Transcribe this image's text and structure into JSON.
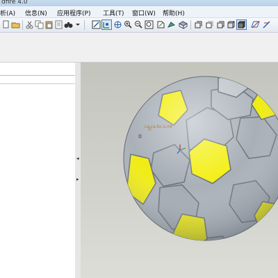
{
  "window": {
    "title": "dfire 4.0"
  },
  "menu": [
    {
      "label": "析(A)"
    },
    {
      "label": "信息(N)"
    },
    {
      "label": "应用程序(P)"
    },
    {
      "label": "工具(T)"
    },
    {
      "label": "窗口(W)"
    },
    {
      "label": "帮助(H)"
    }
  ],
  "toolbar": {
    "icons": [
      "new-icon",
      "open-icon",
      "cut-icon",
      "copy-icon",
      "paste-icon",
      "copy-special-icon",
      "binoculars-icon",
      "dropdown-icon",
      "repaint-icon",
      "spin-center-icon",
      "orient-icon",
      "zoom-in-icon",
      "zoom-out-icon",
      "refit-icon",
      "view-list-icon",
      "view-manager-icon",
      "saved-views-icon",
      "wireframe-icon",
      "hidden-line-icon",
      "no-hidden-icon",
      "shading-icon",
      "datum-plane-icon",
      "datum-axis-icon"
    ],
    "active": [
      "spin-center-icon",
      "shading-icon"
    ]
  },
  "viewport": {
    "coordinate_label": "ca.ca-bc.s.ml",
    "model": "soccer-ball"
  },
  "colors": {
    "ball_gray": "#a9b0b8",
    "ball_yellow": "#f2ee12",
    "background": "#cfd0c9"
  }
}
